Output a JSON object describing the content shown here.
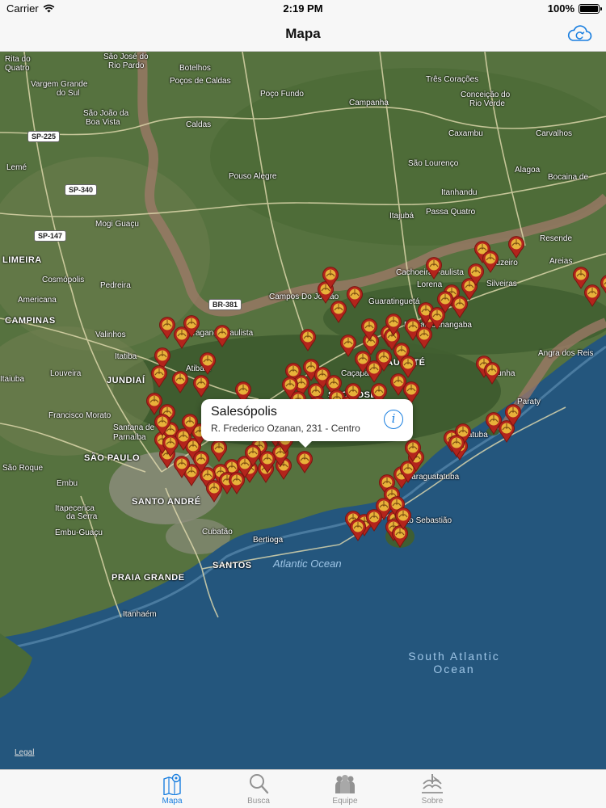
{
  "status_bar": {
    "carrier": "Carrier",
    "time": "2:19 PM",
    "battery": "100%",
    "battery_level": 1.0
  },
  "nav": {
    "title": "Mapa",
    "sync_icon": "cloud-sync-icon"
  },
  "map": {
    "legal": "Legal",
    "callout": {
      "title": "Salesópolis",
      "subtitle": "R. Frederico Ozanan, 231 - Centro",
      "info_icon": "info-icon"
    },
    "places": [
      {
        "name": "Rita do",
        "cls": ""
      },
      {
        "name": "Quatro",
        "cls": ""
      },
      {
        "name": "São José do",
        "cls": ""
      },
      {
        "name": "Rio Pardo",
        "cls": ""
      },
      {
        "name": "Botelhos",
        "cls": ""
      },
      {
        "name": "Vargem Grande",
        "cls": ""
      },
      {
        "name": "do Sul",
        "cls": ""
      },
      {
        "name": "Poços de Caldas",
        "cls": ""
      },
      {
        "name": "Três Corações",
        "cls": ""
      },
      {
        "name": "Poço Fundo",
        "cls": ""
      },
      {
        "name": "Conceição do",
        "cls": ""
      },
      {
        "name": "Rio Verde",
        "cls": ""
      },
      {
        "name": "São João da",
        "cls": ""
      },
      {
        "name": "Boa Vista",
        "cls": ""
      },
      {
        "name": "Campanha",
        "cls": ""
      },
      {
        "name": "Caldas",
        "cls": ""
      },
      {
        "name": "Caxambu",
        "cls": ""
      },
      {
        "name": "Carvalhos",
        "cls": ""
      },
      {
        "name": "Lemé",
        "cls": ""
      },
      {
        "name": "Pouso Alegre",
        "cls": ""
      },
      {
        "name": "São Lourenço",
        "cls": ""
      },
      {
        "name": "Alagoa",
        "cls": ""
      },
      {
        "name": "Bocaina de",
        "cls": ""
      },
      {
        "name": "Itanhandu",
        "cls": ""
      },
      {
        "name": "Mogi Guaçu",
        "cls": ""
      },
      {
        "name": "Itajubá",
        "cls": ""
      },
      {
        "name": "Passa Quatro",
        "cls": ""
      },
      {
        "name": "LIMEIRA",
        "cls": "big"
      },
      {
        "name": "Resende",
        "cls": ""
      },
      {
        "name": "Cosmópolis",
        "cls": ""
      },
      {
        "name": "Cachoeira Paulista",
        "cls": ""
      },
      {
        "name": "Cruzeiro",
        "cls": ""
      },
      {
        "name": "Areias",
        "cls": ""
      },
      {
        "name": "Pedreira",
        "cls": ""
      },
      {
        "name": "Campos Do Jordão",
        "cls": ""
      },
      {
        "name": "Lorena",
        "cls": ""
      },
      {
        "name": "Silveiras",
        "cls": ""
      },
      {
        "name": "Americana",
        "cls": ""
      },
      {
        "name": "Guaratinguetá",
        "cls": ""
      },
      {
        "name": "CAMPINAS",
        "cls": "big"
      },
      {
        "name": "Bragança Paulista",
        "cls": ""
      },
      {
        "name": "Pindamonhangaba",
        "cls": ""
      },
      {
        "name": "Valinhos",
        "cls": ""
      },
      {
        "name": "Itatiba",
        "cls": ""
      },
      {
        "name": "TAUBATÉ",
        "cls": "big"
      },
      {
        "name": "Angra dos Reis",
        "cls": ""
      },
      {
        "name": "Itaiuba",
        "cls": ""
      },
      {
        "name": "Louveira",
        "cls": ""
      },
      {
        "name": "Atibaia",
        "cls": ""
      },
      {
        "name": "Caçapava",
        "cls": ""
      },
      {
        "name": "Cunha",
        "cls": ""
      },
      {
        "name": "JUNDIAÍ",
        "cls": "big"
      },
      {
        "name": "SÃO JOSÉ",
        "cls": "big"
      },
      {
        "name": "Paraty",
        "cls": ""
      },
      {
        "name": "Francisco Morato",
        "cls": ""
      },
      {
        "name": "Santana de",
        "cls": ""
      },
      {
        "name": "Parnaíba",
        "cls": ""
      },
      {
        "name": "Ubatuba",
        "cls": ""
      },
      {
        "name": "SÃO PAULO",
        "cls": "big"
      },
      {
        "name": "São Roque",
        "cls": ""
      },
      {
        "name": "Embu",
        "cls": ""
      },
      {
        "name": "Caraguatatuba",
        "cls": ""
      },
      {
        "name": "SANTO ANDRÉ",
        "cls": "big"
      },
      {
        "name": "Itapecerica",
        "cls": ""
      },
      {
        "name": "da Serra",
        "cls": ""
      },
      {
        "name": "São Sebastião",
        "cls": ""
      },
      {
        "name": "Embu-Guaçu",
        "cls": ""
      },
      {
        "name": "Cubatão",
        "cls": ""
      },
      {
        "name": "Bertioga",
        "cls": ""
      },
      {
        "name": "SANTOS",
        "cls": "big"
      },
      {
        "name": "PRAIA GRANDE",
        "cls": "big"
      },
      {
        "name": "Itanhaém",
        "cls": ""
      }
    ],
    "roads": [
      "SP-225",
      "SP-340",
      "SP-147",
      "BR-381"
    ],
    "oceans": {
      "atlantic": "Atlantic Ocean",
      "south_atlantic_1": "South Atlantic",
      "south_atlantic_2": "Ocean"
    },
    "pin_color": "#b3241c",
    "pin_count": 120
  },
  "tabs": [
    {
      "label": "Mapa",
      "icon": "map-pin-icon",
      "active": true
    },
    {
      "label": "Busca",
      "icon": "search-icon",
      "active": false
    },
    {
      "label": "Equipe",
      "icon": "team-icon",
      "active": false
    },
    {
      "label": "Sobre",
      "icon": "adventist-logo-icon",
      "active": false
    }
  ],
  "colors": {
    "accent": "#1a7fe0",
    "inactive_tab": "#929292"
  }
}
